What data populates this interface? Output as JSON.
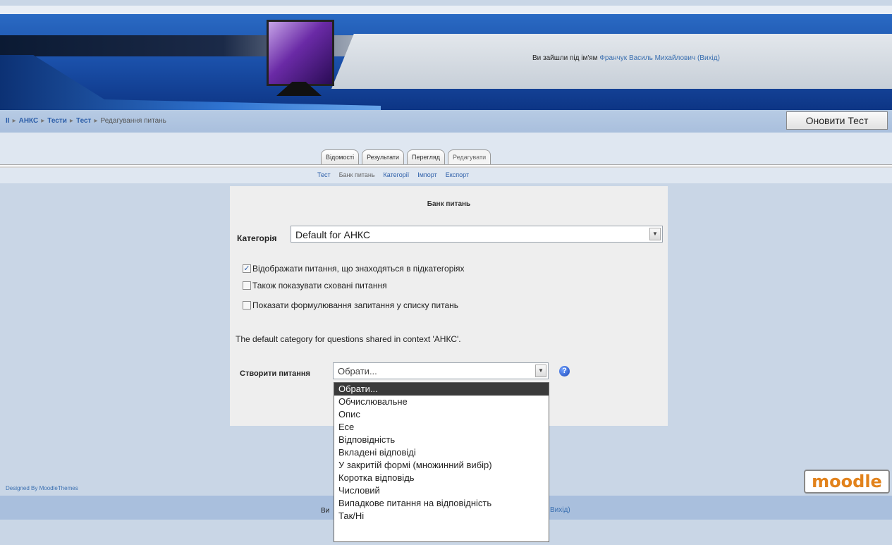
{
  "header": {
    "login_prefix": "Ви зайшли під ім'ям",
    "user_name": "Франчук Василь Михайлович",
    "logout": "(Вихід)"
  },
  "breadcrumb": {
    "home": "ІІ",
    "items": [
      "АНКС",
      "Тести",
      "Тест"
    ],
    "current": "Редагування питань",
    "separator": "▸"
  },
  "update_button": "Оновити Тест",
  "tabs": [
    "Відомості",
    "Результати",
    "Перегляд",
    "Редагувати"
  ],
  "subtabs": [
    "Тест",
    "Банк питань",
    "Категорії",
    "Імпорт",
    "Експорт"
  ],
  "panel": {
    "title": "Банк питань",
    "category_label": "Категорія",
    "category_value": "Default for АНКС",
    "checkboxes": [
      {
        "label": "Відображати питання, що знаходяться в підкатегоріях",
        "checked": true
      },
      {
        "label": "Також показувати сховані питання",
        "checked": false
      },
      {
        "label": "Показати формулювання запитання у списку питань",
        "checked": false
      }
    ],
    "default_text": "The default category for questions shared in context 'АНКС'.",
    "create_label": "Створити питання",
    "create_value": "Обрати...",
    "help_icon": "question-icon"
  },
  "dropdown": {
    "options": [
      "Обрати...",
      "Обчислювальне",
      "Опис",
      "Есе",
      "Відповідність",
      "Вкладені відповіді",
      "У закритій формі (множинний вибір)",
      "Коротка відповідь",
      "Числовий",
      "Випадкове питання на відповідність",
      "Так/Ні"
    ],
    "selected_index": 0
  },
  "footer": {
    "designed_by": "Designed By MoodleThemes",
    "logo_text": "moodle",
    "frag_left": "Ви",
    "frag_right": "Вихід)"
  },
  "colors": {
    "header_blue": "#1a4fa8",
    "link": "#2b5da8",
    "moodle_orange": "#e2821b"
  }
}
